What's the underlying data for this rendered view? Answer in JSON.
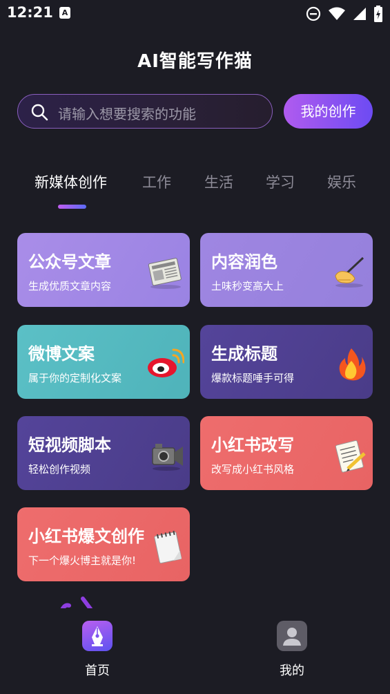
{
  "status_bar": {
    "time": "12:21",
    "app_letter": "A",
    "icons": [
      "dnd-icon",
      "wifi-icon",
      "signal-icon",
      "battery-charging-icon"
    ]
  },
  "app_title": "AI智能写作猫",
  "search": {
    "placeholder": "请输入想要搜索的功能",
    "icon": "search-icon"
  },
  "my_create_button": "我的创作",
  "tabs": [
    {
      "label": "新媒体创作",
      "active": true
    },
    {
      "label": "工作",
      "active": false
    },
    {
      "label": "生活",
      "active": false
    },
    {
      "label": "学习",
      "active": false
    },
    {
      "label": "娱乐",
      "active": false
    }
  ],
  "cards": [
    {
      "title": "公众号文章",
      "subtitle": "生成优质文章内容",
      "icon": "newspaper-icon",
      "color": "#a58ae6"
    },
    {
      "title": "内容润色",
      "subtitle": "土味秒变高大上",
      "icon": "writing-hand-icon",
      "color": "#9a82df"
    },
    {
      "title": "微博文案",
      "subtitle": "属于你的定制化文案",
      "icon": "weibo-icon",
      "color": "#56b9c0"
    },
    {
      "title": "生成标题",
      "subtitle": "爆款标题唾手可得",
      "icon": "fire-icon",
      "color": "#4f3f8c"
    },
    {
      "title": "短视频脚本",
      "subtitle": "轻松创作视频",
      "icon": "video-camera-icon",
      "color": "#4f3f8c"
    },
    {
      "title": "小红书改写",
      "subtitle": "改写成小红书风格",
      "icon": "memo-icon",
      "color": "#ea6a6a"
    },
    {
      "title": "小红书爆文创作",
      "subtitle": "下一个爆火博主就是你!",
      "icon": "notepad-icon",
      "color": "#ea6a6a"
    }
  ],
  "bottom_nav": [
    {
      "label": "首页",
      "icon": "pen-nib-icon",
      "active": true
    },
    {
      "label": "我的",
      "icon": "user-icon",
      "active": false
    }
  ],
  "colors": {
    "background": "#1c1c24",
    "accent_gradient_start": "#b05bef",
    "accent_gradient_end": "#6d4bf2"
  }
}
